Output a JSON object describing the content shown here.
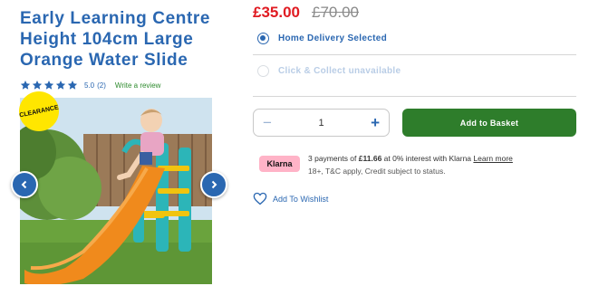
{
  "product": {
    "title": "Early Learning Centre Height 104cm Large Orange Water Slide",
    "rating_score": "5.0",
    "rating_count": "(2)",
    "rating_stars": 5,
    "write_review_label": "Write a review",
    "badge": "CLEARANCE"
  },
  "pricing": {
    "current": "£35.00",
    "was": "£70.00"
  },
  "fulfilment": {
    "home_delivery_label": "Home Delivery Selected",
    "click_collect_label": "Click & Collect unavailable"
  },
  "basket": {
    "quantity": "1",
    "minus_symbol": "−",
    "plus_symbol": "+",
    "add_label": "Add to Basket"
  },
  "klarna": {
    "badge": "Klarna",
    "line1_prefix": "3 payments of ",
    "amount": "£11.66",
    "line1_suffix": " at 0% interest with Klarna ",
    "learn_more": "Learn more",
    "line2": "18+, T&C apply, Credit subject to status."
  },
  "wishlist": {
    "label": "Add To Wishlist"
  },
  "colors": {
    "brand_blue": "#2a67b1",
    "price_red": "#e01b22",
    "basket_green": "#2e7d2b",
    "klarna_pink": "#ffb3c7",
    "clearance_yellow": "#ffe600"
  },
  "icons": {
    "star": "star-icon",
    "prev": "chevron-left-icon",
    "next": "chevron-right-icon",
    "wishlist": "heart-icon"
  }
}
